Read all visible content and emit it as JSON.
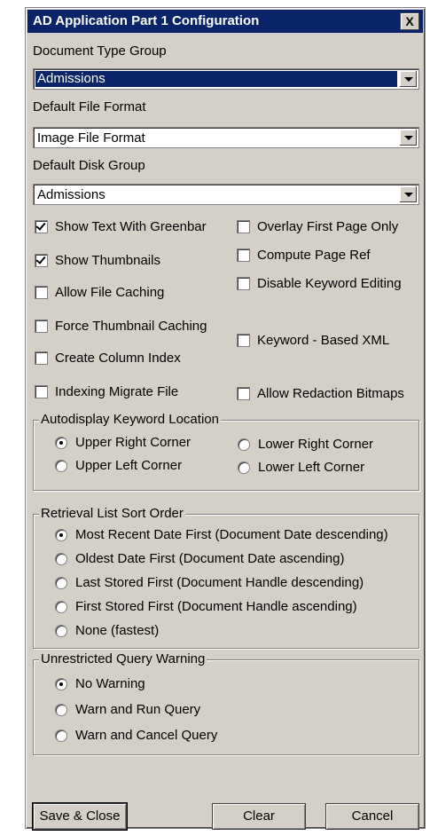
{
  "window": {
    "title": "AD Application Part 1 Configuration",
    "close_glyph": "X"
  },
  "fields": {
    "doc_type_group": {
      "label": "Document Type Group",
      "value": "Admissions"
    },
    "file_format": {
      "label": "Default File Format",
      "value": "Image File Format"
    },
    "disk_group": {
      "label": "Default Disk Group",
      "value": "Admissions"
    }
  },
  "options_left": [
    {
      "label": "Show Text With Greenbar",
      "checked": true
    },
    {
      "label": "Show Thumbnails",
      "checked": true
    },
    {
      "label": "Allow File Caching",
      "checked": false
    },
    {
      "label": "Force Thumbnail Caching",
      "checked": false
    },
    {
      "label": "Create Column Index",
      "checked": false
    },
    {
      "label": "Indexing Migrate File",
      "checked": false
    }
  ],
  "options_right": [
    {
      "label": "Overlay First Page Only",
      "checked": false
    },
    {
      "label": "Compute Page Ref",
      "checked": false
    },
    {
      "label": "Disable Keyword Editing",
      "checked": false
    },
    {
      "label": "Keyword - Based XML",
      "checked": false
    },
    {
      "label": "Allow Redaction Bitmaps",
      "checked": false
    }
  ],
  "autodisplay": {
    "legend": "Autodisplay Keyword Location",
    "options": [
      {
        "label": "Upper Right Corner",
        "selected": true
      },
      {
        "label": "Lower Right Corner",
        "selected": false
      },
      {
        "label": "Upper Left Corner",
        "selected": false
      },
      {
        "label": "Lower Left Corner",
        "selected": false
      }
    ]
  },
  "sort_order": {
    "legend": "Retrieval List Sort Order",
    "options": [
      {
        "label": "Most Recent Date First (Document Date descending)",
        "selected": true
      },
      {
        "label": "Oldest Date First (Document Date ascending)",
        "selected": false
      },
      {
        "label": "Last Stored First (Document Handle descending)",
        "selected": false
      },
      {
        "label": "First Stored First (Document Handle ascending)",
        "selected": false
      },
      {
        "label": "None (fastest)",
        "selected": false
      }
    ]
  },
  "query_warning": {
    "legend": "Unrestricted Query Warning",
    "options": [
      {
        "label": "No Warning",
        "selected": true
      },
      {
        "label": "Warn and Run Query",
        "selected": false
      },
      {
        "label": "Warn and Cancel Query",
        "selected": false
      }
    ]
  },
  "buttons": {
    "save_close": "Save & Close",
    "clear": "Clear",
    "cancel": "Cancel"
  }
}
